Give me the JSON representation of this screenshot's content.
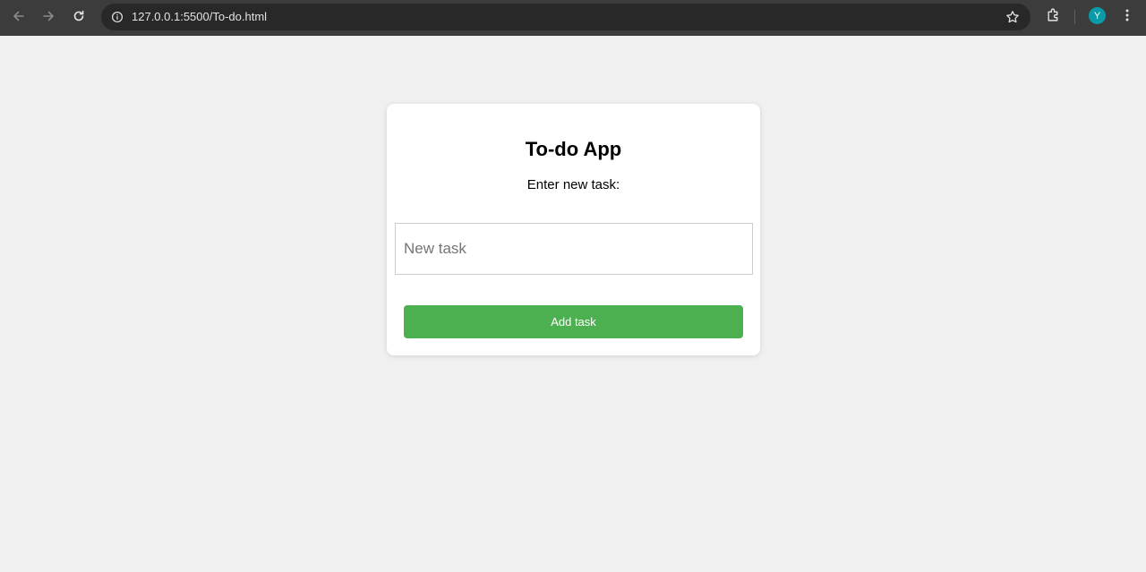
{
  "browser": {
    "url": "127.0.0.1:5500/To-do.html",
    "profile_initial": "Y",
    "icons": {
      "back": "arrow-left-icon",
      "forward": "arrow-right-icon",
      "reload": "reload-icon",
      "site_info": "info-icon",
      "bookmark": "star-icon",
      "extensions": "puzzle-icon",
      "menu": "kebab-menu-icon"
    }
  },
  "app": {
    "title": "To-do App",
    "prompt": "Enter new task:",
    "input": {
      "value": "",
      "placeholder": "New task"
    },
    "add_button_label": "Add task",
    "accent_color": "#4caf50",
    "background_color": "#f0f0f0"
  }
}
